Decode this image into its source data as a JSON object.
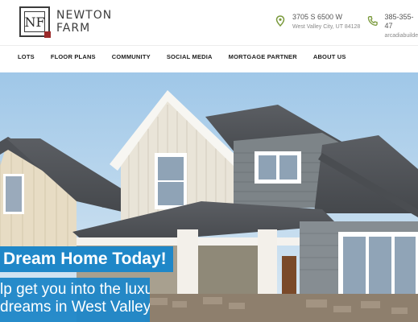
{
  "brand": {
    "mark": "NF",
    "name_line1": "NEWTON",
    "name_line2": "FARM",
    "accent_color": "#9b2a2a"
  },
  "contact": {
    "address": {
      "icon": "map-pin-icon",
      "line1": "3705 S 6500 W",
      "line2": "West Valley City, UT 84128"
    },
    "phone": {
      "icon": "phone-icon",
      "line1": "385-355-47",
      "line2": "arcadiabuilder"
    },
    "icon_color": "#7a9a3c"
  },
  "nav": {
    "items": [
      {
        "label": "LOTS"
      },
      {
        "label": "FLOOR PLANS"
      },
      {
        "label": "COMMUNITY"
      },
      {
        "label": "SOCIAL MEDIA"
      },
      {
        "label": "MORTGAGE PARTNER"
      },
      {
        "label": "ABOUT US"
      }
    ]
  },
  "hero": {
    "headline": "Dream Home Today!",
    "subline1": "lp get you into the luxury",
    "subline2": "dreams in West Valley!",
    "banner_color": "#1f87c8"
  }
}
